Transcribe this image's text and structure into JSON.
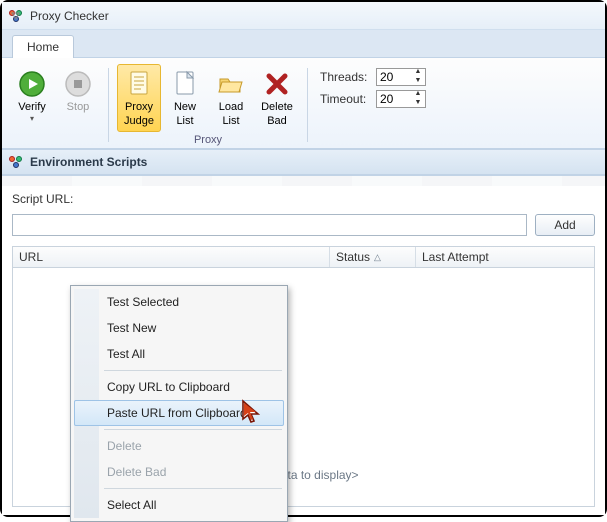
{
  "titlebar": {
    "title": "Proxy Checker"
  },
  "tabs": {
    "home": "Home"
  },
  "ribbon": {
    "verify": "Verify",
    "stop": "Stop",
    "proxy_judge_l1": "Proxy",
    "proxy_judge_l2": "Judge",
    "new_list_l1": "New",
    "new_list_l2": "List",
    "load_list_l1": "Load",
    "load_list_l2": "List",
    "delete_bad_l1": "Delete",
    "delete_bad_l2": "Bad",
    "group_proxy": "Proxy",
    "threads_label": "Threads:",
    "threads_value": "20",
    "timeout_label": "Timeout:",
    "timeout_value": "20"
  },
  "subpanel": {
    "title": "Environment Scripts"
  },
  "form": {
    "script_url_label": "Script URL:",
    "script_url_value": "",
    "add": "Add"
  },
  "grid": {
    "url": "URL",
    "status": "Status",
    "last": "Last Attempt",
    "nodata": "<No data to display>"
  },
  "contextmenu": {
    "test_selected": "Test Selected",
    "test_new": "Test New",
    "test_all": "Test All",
    "copy_url": "Copy URL to Clipboard",
    "paste_url": "Paste URL from Clipboard",
    "delete": "Delete",
    "delete_bad": "Delete Bad",
    "select_all": "Select All"
  }
}
